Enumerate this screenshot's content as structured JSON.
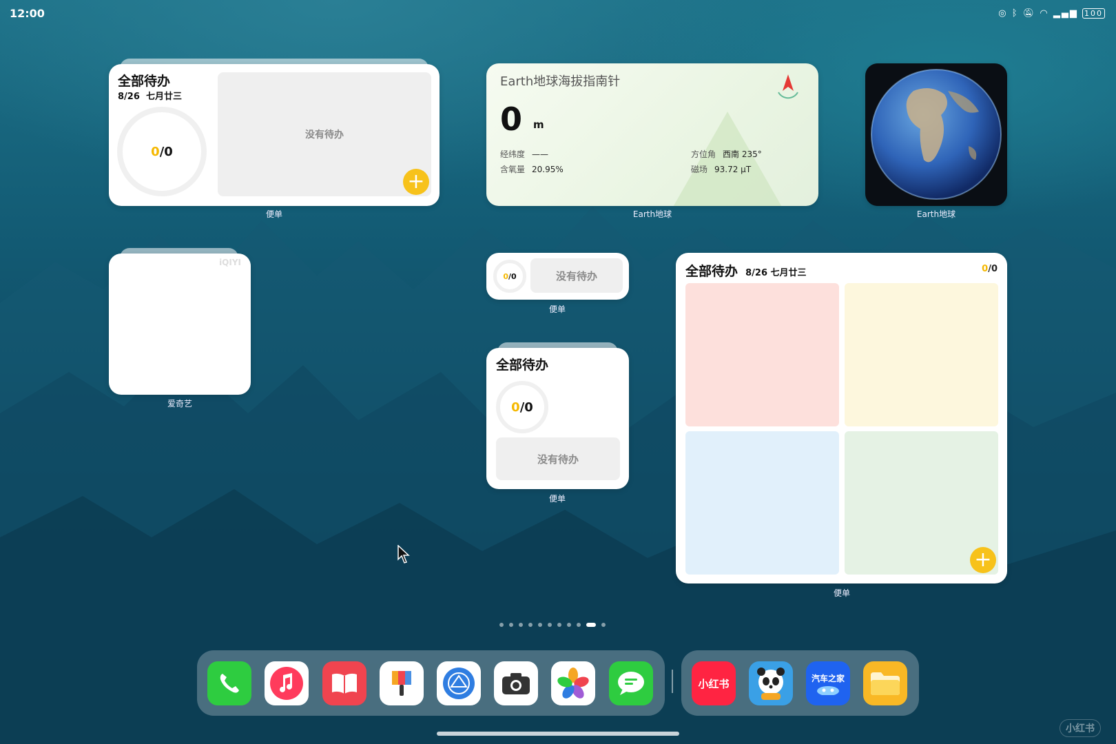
{
  "status_bar": {
    "time": "12:00",
    "battery": "100"
  },
  "widgets": {
    "notes_large_top": {
      "title": "全部待办",
      "date_num": "8/26",
      "date_lunar": "七月廿三",
      "ratio_done": "0",
      "ratio_total": "/0",
      "empty_text": "没有待办",
      "label": "便单"
    },
    "earth_altitude": {
      "title": "Earth地球海拔指南针",
      "altitude_value": "0",
      "altitude_unit": "m",
      "latlon_key": "经纬度",
      "latlon_value": "——",
      "oxygen_key": "含氧量",
      "oxygen_value": "20.95%",
      "azimuth_key": "方位角",
      "azimuth_value": "西南 235°",
      "magnetic_key": "磁场",
      "magnetic_value": "93.72 μT",
      "label": "Earth地球"
    },
    "earth_globe": {
      "label": "Earth地球"
    },
    "iqiyi": {
      "label": "爱奇艺"
    },
    "notes_small": {
      "ratio_done": "0",
      "ratio_total": "/0",
      "empty_text": "没有待办",
      "label": "便单"
    },
    "notes_medium": {
      "title": "全部待办",
      "ratio_done": "0",
      "ratio_total": "/0",
      "empty_text": "没有待办",
      "label": "便单"
    },
    "notes_large_right": {
      "title": "全部待办",
      "date": "8/26 七月廿三",
      "ratio_done": "0",
      "ratio_total": "/0",
      "label": "便单"
    }
  },
  "page_indicator": {
    "count": 11,
    "active_index": 9
  },
  "dock": {
    "apps": [
      {
        "name": "phone-app",
        "color": "#2ecc40"
      },
      {
        "name": "music-app",
        "color": "#ffffff"
      },
      {
        "name": "books-app",
        "color": "#f0444f"
      },
      {
        "name": "themes-app",
        "color": "#ffffff"
      },
      {
        "name": "browser-app",
        "color": "#ffffff"
      },
      {
        "name": "camera-app",
        "color": "#ffffff"
      },
      {
        "name": "gallery-app",
        "color": "#ffffff"
      },
      {
        "name": "messages-app",
        "color": "#2ecc40"
      }
    ],
    "recent_apps": [
      {
        "name": "xiaohongshu-app",
        "text": "小红书",
        "color": "#ff2442"
      },
      {
        "name": "panda-game-app",
        "color": "#3aa0e6"
      },
      {
        "name": "autohome-app",
        "text": "汽车之家",
        "color": "#1f63f0"
      },
      {
        "name": "files-app",
        "color": "#f9b825"
      }
    ]
  },
  "watermark": "小红书"
}
